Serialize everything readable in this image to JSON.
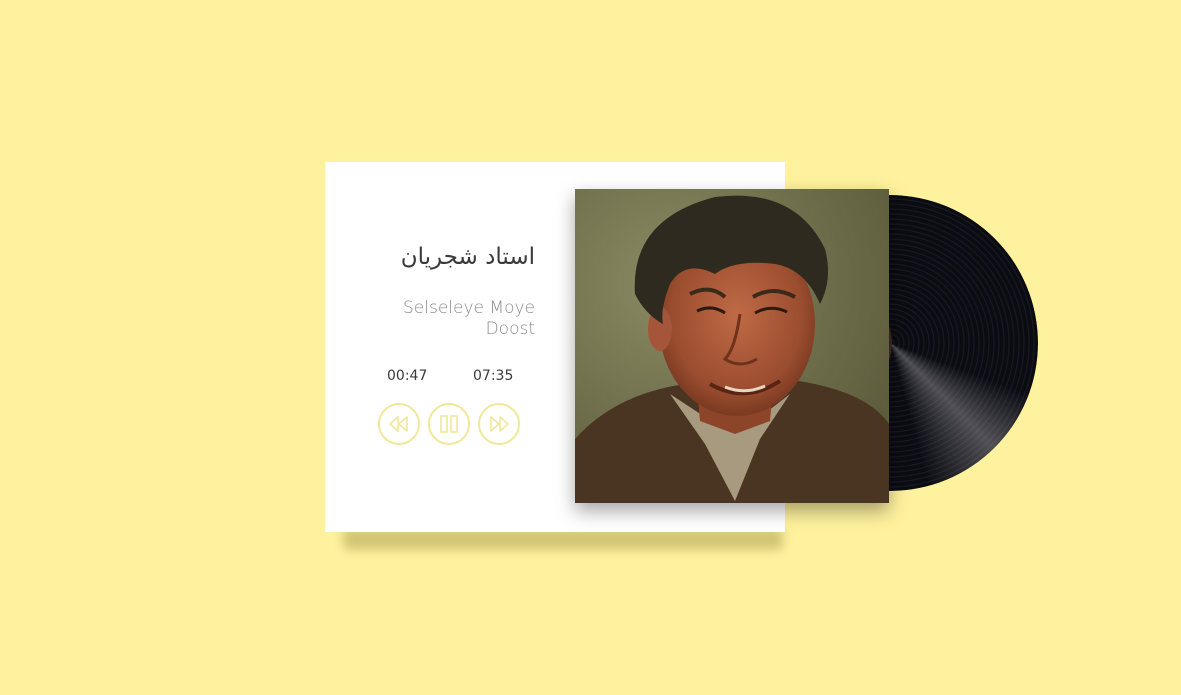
{
  "player": {
    "artist": "استاد شجریان",
    "track_title": "Selseleye Moye Doost",
    "track_title_line1": "Selseleye Moye",
    "track_title_line2": "Doost",
    "current_time": "00:47",
    "total_time": "07:35",
    "controls": {
      "rewind_icon": "rewind-icon",
      "pause_icon": "pause-icon",
      "forward_icon": "fast-forward-icon"
    },
    "album_art": "artist-portrait",
    "vinyl": "vinyl-record-icon"
  },
  "colors": {
    "background": "#fef29e",
    "card": "#ffffff",
    "control_outline": "#f0e89a",
    "artist_text": "#3a3a3a",
    "track_text": "#8a8a8a"
  }
}
